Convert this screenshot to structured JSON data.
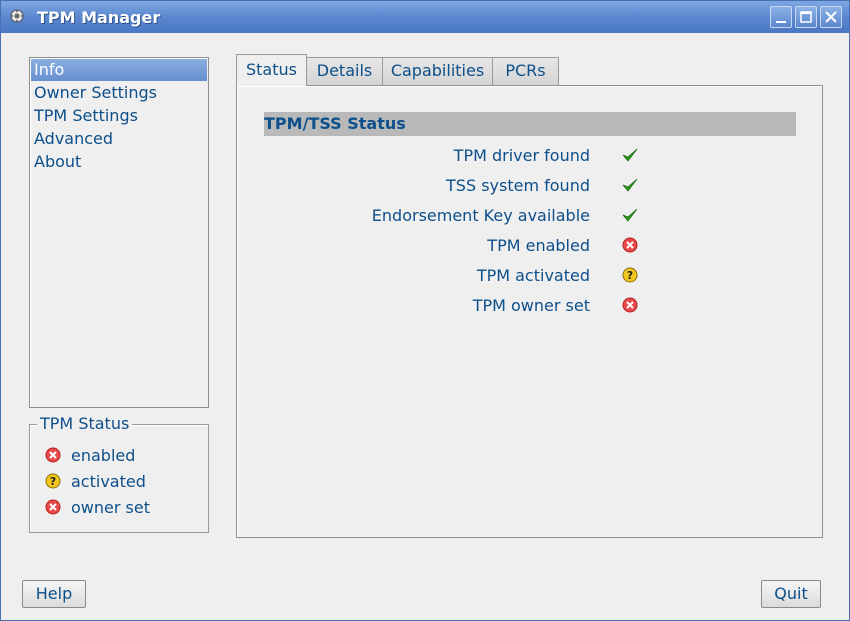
{
  "window": {
    "title": "TPM Manager",
    "controls": [
      "minimize",
      "maximize",
      "close"
    ]
  },
  "sidebar": {
    "items": [
      {
        "label": "Info",
        "selected": true
      },
      {
        "label": "Owner Settings",
        "selected": false
      },
      {
        "label": "TPM Settings",
        "selected": false
      },
      {
        "label": "Advanced",
        "selected": false
      },
      {
        "label": "About",
        "selected": false
      }
    ]
  },
  "status_group": {
    "title": "TPM Status",
    "items": [
      {
        "label": "enabled",
        "icon": "error-icon"
      },
      {
        "label": "activated",
        "icon": "question-icon"
      },
      {
        "label": "owner set",
        "icon": "error-icon"
      }
    ]
  },
  "tabs": [
    {
      "label": "Status",
      "active": true
    },
    {
      "label": "Details",
      "active": false
    },
    {
      "label": "Capabilities",
      "active": false
    },
    {
      "label": "PCRs",
      "active": false
    }
  ],
  "status_panel": {
    "section_title": "TPM/TSS Status",
    "rows": [
      {
        "label": "TPM driver found",
        "icon": "check-icon"
      },
      {
        "label": "TSS system found",
        "icon": "check-icon"
      },
      {
        "label": "Endorsement Key available",
        "icon": "check-icon"
      },
      {
        "label": "TPM enabled",
        "icon": "error-icon"
      },
      {
        "label": "TPM activated",
        "icon": "question-icon"
      },
      {
        "label": "TPM owner set",
        "icon": "error-icon"
      }
    ]
  },
  "buttons": {
    "help": "Help",
    "quit": "Quit"
  },
  "colors": {
    "titlebar": "#5b88cf",
    "selection": "#7aa0d8",
    "text": "#0d4f8a",
    "ok": "#2a9a1e",
    "error": "#e03a3a",
    "warning": "#f2c21a"
  }
}
